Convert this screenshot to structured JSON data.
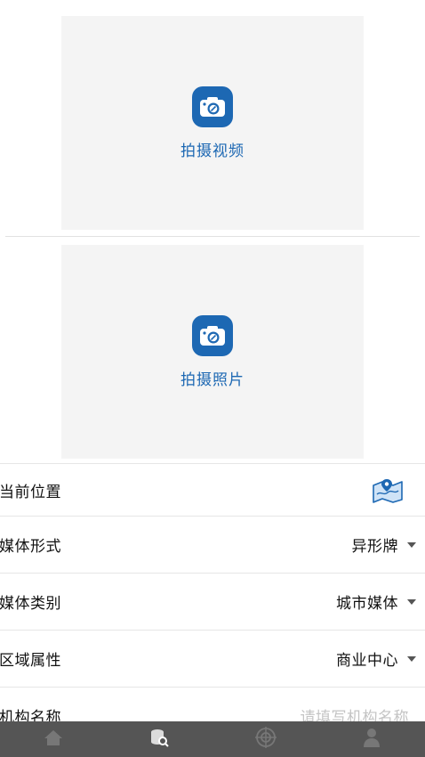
{
  "video_capture": {
    "label": "拍摄视频",
    "icon": "camera-icon"
  },
  "photo_capture": {
    "label": "拍摄照片",
    "icon": "camera-icon"
  },
  "form": {
    "location": {
      "label": "当前位置",
      "icon": "map-location-icon"
    },
    "media_form": {
      "label": "媒体形式",
      "value": "异形牌"
    },
    "media_category": {
      "label": "媒体类别",
      "value": "城市媒体"
    },
    "area_attribute": {
      "label": "区域属性",
      "value": "商业中心"
    },
    "org_name": {
      "label": "机构名称",
      "placeholder": "请填写机构名称"
    }
  },
  "tabbar": {
    "items": [
      {
        "icon": "home-icon"
      },
      {
        "icon": "database-search-icon"
      },
      {
        "icon": "target-icon"
      },
      {
        "icon": "user-icon"
      }
    ]
  },
  "colors": {
    "accent": "#1d68b3",
    "card_bg": "#f4f4f4",
    "tabbar_bg": "#555555"
  }
}
